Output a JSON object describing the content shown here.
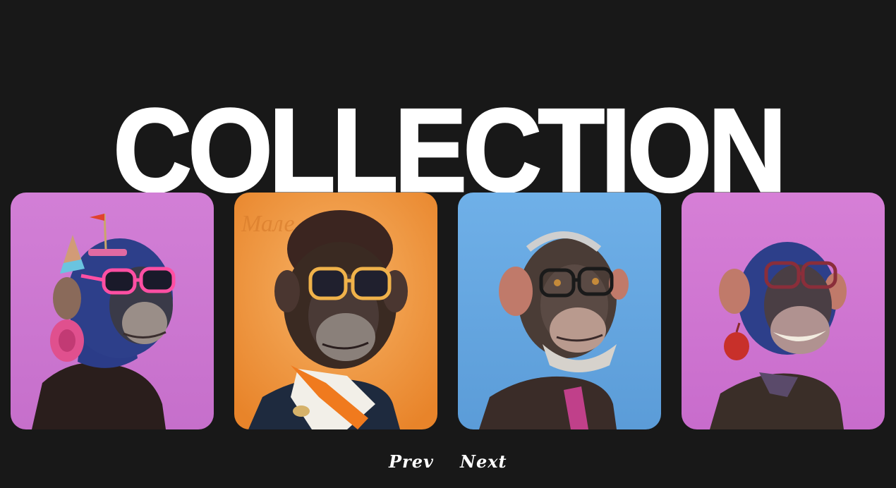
{
  "page": {
    "title": "COLLECTION"
  },
  "collection": {
    "cards": [
      {
        "background": "#cf7bd4",
        "fur": "#2d3f8a"
      },
      {
        "background": "#f0963c",
        "fur": "#3b2a22"
      },
      {
        "background": "#6aa9e2",
        "fur": "#4a3b34"
      },
      {
        "background": "#cf7bd4",
        "fur": "#2d3f8a"
      }
    ]
  },
  "nav": {
    "prev_label": "Prev",
    "next_label": "Next"
  }
}
